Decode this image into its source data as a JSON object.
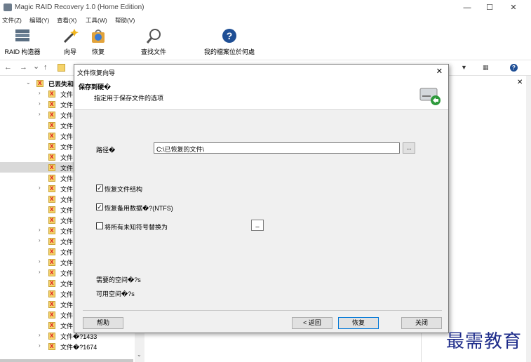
{
  "window": {
    "title": "Magic RAID Recovery 1.0 (Home Edition)",
    "minimize": "—",
    "maximize": "☐",
    "close": "✕"
  },
  "menu": [
    "文件(Z)",
    "编辑(Y)",
    "查看(X)",
    "工具(W)",
    "帮助(V)"
  ],
  "toolbar": {
    "raid_builder": "RAID 构造器",
    "wizard": "向导",
    "recover": "恢复",
    "find_file": "查找文件",
    "my_files": "我的檔案位於何處"
  },
  "nav": {
    "back": "←",
    "forward": "→",
    "down": "⌄",
    "up": "↑",
    "filter": "▼",
    "view": "▦",
    "help": "?"
  },
  "tree": {
    "root_label": "已丟失和",
    "rows": [
      {
        "label": "文件",
        "expand": true,
        "selected": false
      },
      {
        "label": "文件",
        "expand": true,
        "selected": false
      },
      {
        "label": "文件",
        "expand": true,
        "selected": false
      },
      {
        "label": "文件",
        "expand": false,
        "selected": false
      },
      {
        "label": "文件",
        "expand": false,
        "selected": false
      },
      {
        "label": "文件",
        "expand": false,
        "selected": false
      },
      {
        "label": "文件",
        "expand": false,
        "selected": false
      },
      {
        "label": "文件",
        "expand": false,
        "selected": true
      },
      {
        "label": "文件",
        "expand": false,
        "selected": false
      },
      {
        "label": "文件",
        "expand": true,
        "selected": false
      },
      {
        "label": "文件",
        "expand": false,
        "selected": false
      },
      {
        "label": "文件",
        "expand": false,
        "selected": false
      },
      {
        "label": "文件",
        "expand": false,
        "selected": false
      },
      {
        "label": "文件",
        "expand": true,
        "selected": false
      },
      {
        "label": "文件",
        "expand": true,
        "selected": false
      },
      {
        "label": "文件",
        "expand": false,
        "selected": false
      },
      {
        "label": "文件",
        "expand": true,
        "selected": false
      },
      {
        "label": "文件",
        "expand": true,
        "selected": false
      },
      {
        "label": "文件",
        "expand": false,
        "selected": false
      },
      {
        "label": "文件",
        "expand": false,
        "selected": false
      },
      {
        "label": "文件",
        "expand": false,
        "selected": false
      },
      {
        "label": "文件",
        "expand": false,
        "selected": false
      },
      {
        "label": "文件",
        "expand": false,
        "selected": false
      },
      {
        "label": "文件�?1433",
        "expand": true,
        "selected": false
      },
      {
        "label": "文件�?1674",
        "expand": true,
        "selected": false
      }
    ]
  },
  "dialog": {
    "title": "文件恢复向导",
    "close": "✕",
    "header_title": "保存到硬�",
    "header_subtitle": "指定用于保存文件的选项",
    "path_label": "路径�",
    "path_value": "C:\\已恢复的文件\\",
    "browse": "...",
    "opt_structure": "恢复文件结构",
    "opt_structure_checked": true,
    "opt_alt_streams": "恢复备用数据�?(NTFS)",
    "opt_alt_checked": true,
    "opt_replace": "将所有未知符号替换为",
    "opt_replace_checked": false,
    "replace_char": "_",
    "space_needed": "需要的空间�?s",
    "space_available": "可用空间�?s",
    "help": "帮助",
    "back": "< 返回",
    "recover": "恢复",
    "close_btn": "关闭"
  },
  "watermark": "最需教育",
  "colors": {
    "accent": "#0078d7",
    "watermark": "#1d2b8a"
  }
}
